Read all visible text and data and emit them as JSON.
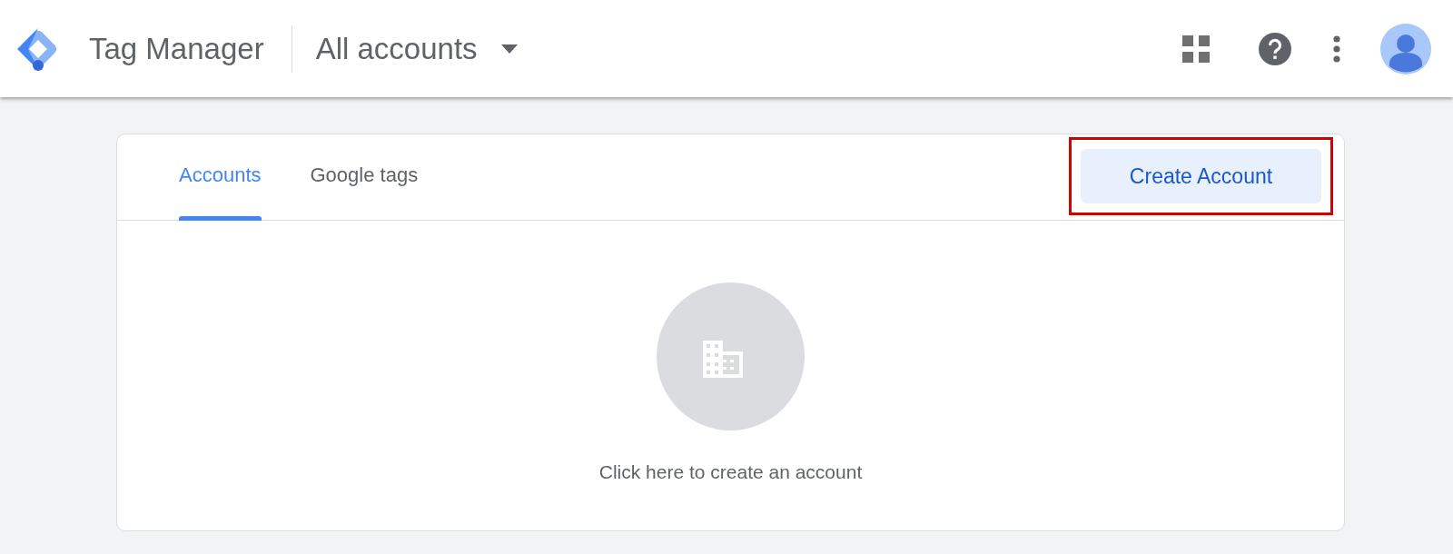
{
  "header": {
    "product": "Tag Manager",
    "account_selector": "All accounts"
  },
  "tabs": [
    {
      "label": "Accounts",
      "selected": true
    },
    {
      "label": "Google tags",
      "selected": false
    }
  ],
  "create_button": {
    "label": "Create Account",
    "highlighted": true
  },
  "empty_state": {
    "message": "Click here to create an account"
  }
}
